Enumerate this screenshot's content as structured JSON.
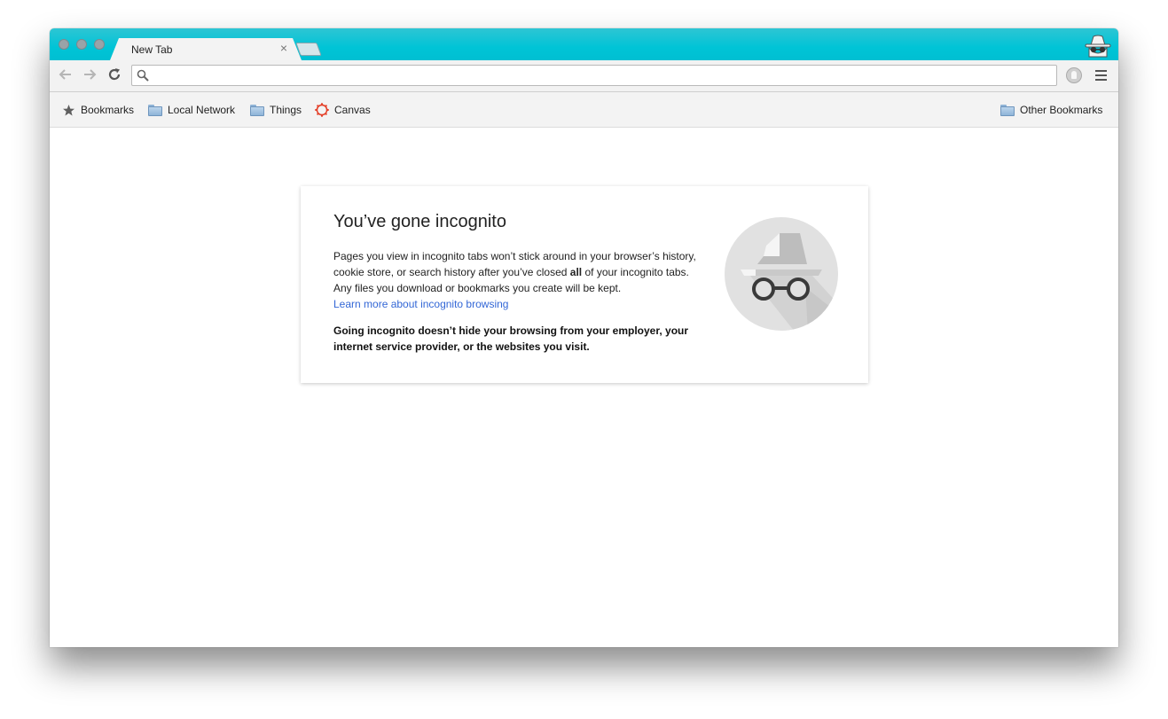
{
  "tabs": [
    {
      "title": "New Tab",
      "close_label": "×",
      "active": true
    }
  ],
  "toolbar": {
    "back_icon": "arrow-left-icon",
    "forward_icon": "arrow-right-icon",
    "reload_icon": "reload-icon",
    "omnibox_value": "",
    "omnibox_placeholder": ""
  },
  "bookmarks": {
    "items": [
      {
        "label": "Bookmarks",
        "icon": "star-icon"
      },
      {
        "label": "Local Network",
        "icon": "folder-icon"
      },
      {
        "label": "Things",
        "icon": "folder-icon"
      },
      {
        "label": "Canvas",
        "icon": "canvas-logo-icon"
      }
    ],
    "other": {
      "label": "Other Bookmarks",
      "icon": "folder-icon"
    }
  },
  "incognito": {
    "heading": "You’ve gone incognito",
    "para1_a": "Pages you view in incognito tabs won’t stick around in your browser’s history, cookie store, or search history after you’ve closed ",
    "para1_bold": "all",
    "para1_b": " of your incognito tabs. Any files you download or bookmarks you create will be kept.",
    "learn_more": "Learn more about incognito browsing",
    "para2": "Going incognito doesn’t hide your browsing from your employer, your internet service provider, or the websites you visit."
  },
  "colors": {
    "tabstrip": "#00c4d6",
    "link": "#3367d6",
    "canvas_logo": "#e4412a"
  }
}
